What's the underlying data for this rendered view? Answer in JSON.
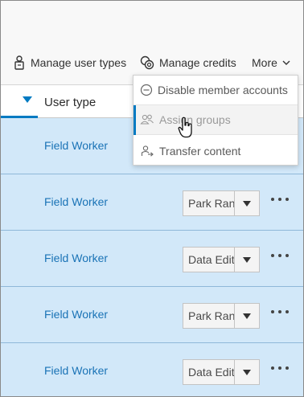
{
  "toolbar": {
    "manage_user_types": {
      "label": "Manage user types",
      "icon": "user-badge-icon"
    },
    "manage_credits": {
      "label": "Manage credits",
      "icon": "credits-icon"
    },
    "more": {
      "label": "More",
      "icon": "chevron-down-icon"
    }
  },
  "table": {
    "sort_icon": "sort-descending-icon",
    "column_header": "User type",
    "rows": [
      {
        "user_type": "Field Worker",
        "role": "",
        "has_select": false
      },
      {
        "user_type": "Field Worker",
        "role": "Park Ranger",
        "has_select": true
      },
      {
        "user_type": "Field Worker",
        "role": "Data Editor",
        "has_select": true
      },
      {
        "user_type": "Field Worker",
        "role": "Park Ranger",
        "has_select": true
      },
      {
        "user_type": "Field Worker",
        "role": "Data Editor",
        "has_select": true
      }
    ]
  },
  "menu": {
    "items": [
      {
        "label": "Disable member accounts",
        "icon": "minus-circle-icon"
      },
      {
        "label": "Assign groups",
        "icon": "group-icon",
        "state": "hover"
      },
      {
        "label": "Transfer content",
        "icon": "transfer-user-icon"
      }
    ]
  },
  "colors": {
    "accent": "#007ac2",
    "row_selected": "#d2e8f9",
    "link": "#1a73b6"
  }
}
